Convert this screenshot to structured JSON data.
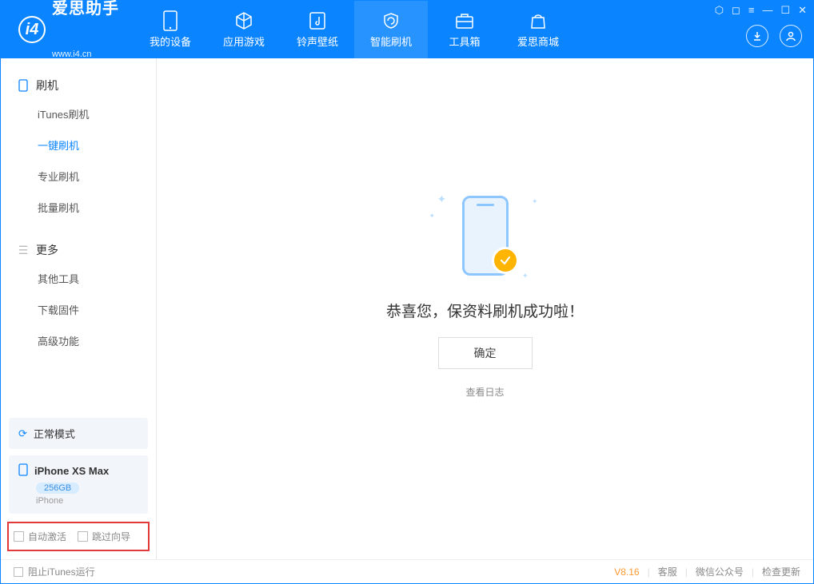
{
  "app": {
    "name": "爱思助手",
    "url": "www.i4.cn"
  },
  "tabs": [
    {
      "label": "我的设备"
    },
    {
      "label": "应用游戏"
    },
    {
      "label": "铃声壁纸"
    },
    {
      "label": "智能刷机"
    },
    {
      "label": "工具箱"
    },
    {
      "label": "爱思商城"
    }
  ],
  "sidebar": {
    "section1": {
      "title": "刷机",
      "items": [
        {
          "label": "iTunes刷机"
        },
        {
          "label": "一键刷机"
        },
        {
          "label": "专业刷机"
        },
        {
          "label": "批量刷机"
        }
      ]
    },
    "section2": {
      "title": "更多",
      "items": [
        {
          "label": "其他工具"
        },
        {
          "label": "下载固件"
        },
        {
          "label": "高级功能"
        }
      ]
    },
    "status": "正常模式",
    "device": {
      "name": "iPhone XS Max",
      "capacity": "256GB",
      "type": "iPhone"
    },
    "checks": {
      "autoActivate": "自动激活",
      "skipGuide": "跳过向导"
    }
  },
  "main": {
    "successText": "恭喜您，保资料刷机成功啦！",
    "okButton": "确定",
    "logLink": "查看日志"
  },
  "footer": {
    "blockItunes": "阻止iTunes运行",
    "version": "V8.16",
    "support": "客服",
    "wechat": "微信公众号",
    "update": "检查更新"
  }
}
